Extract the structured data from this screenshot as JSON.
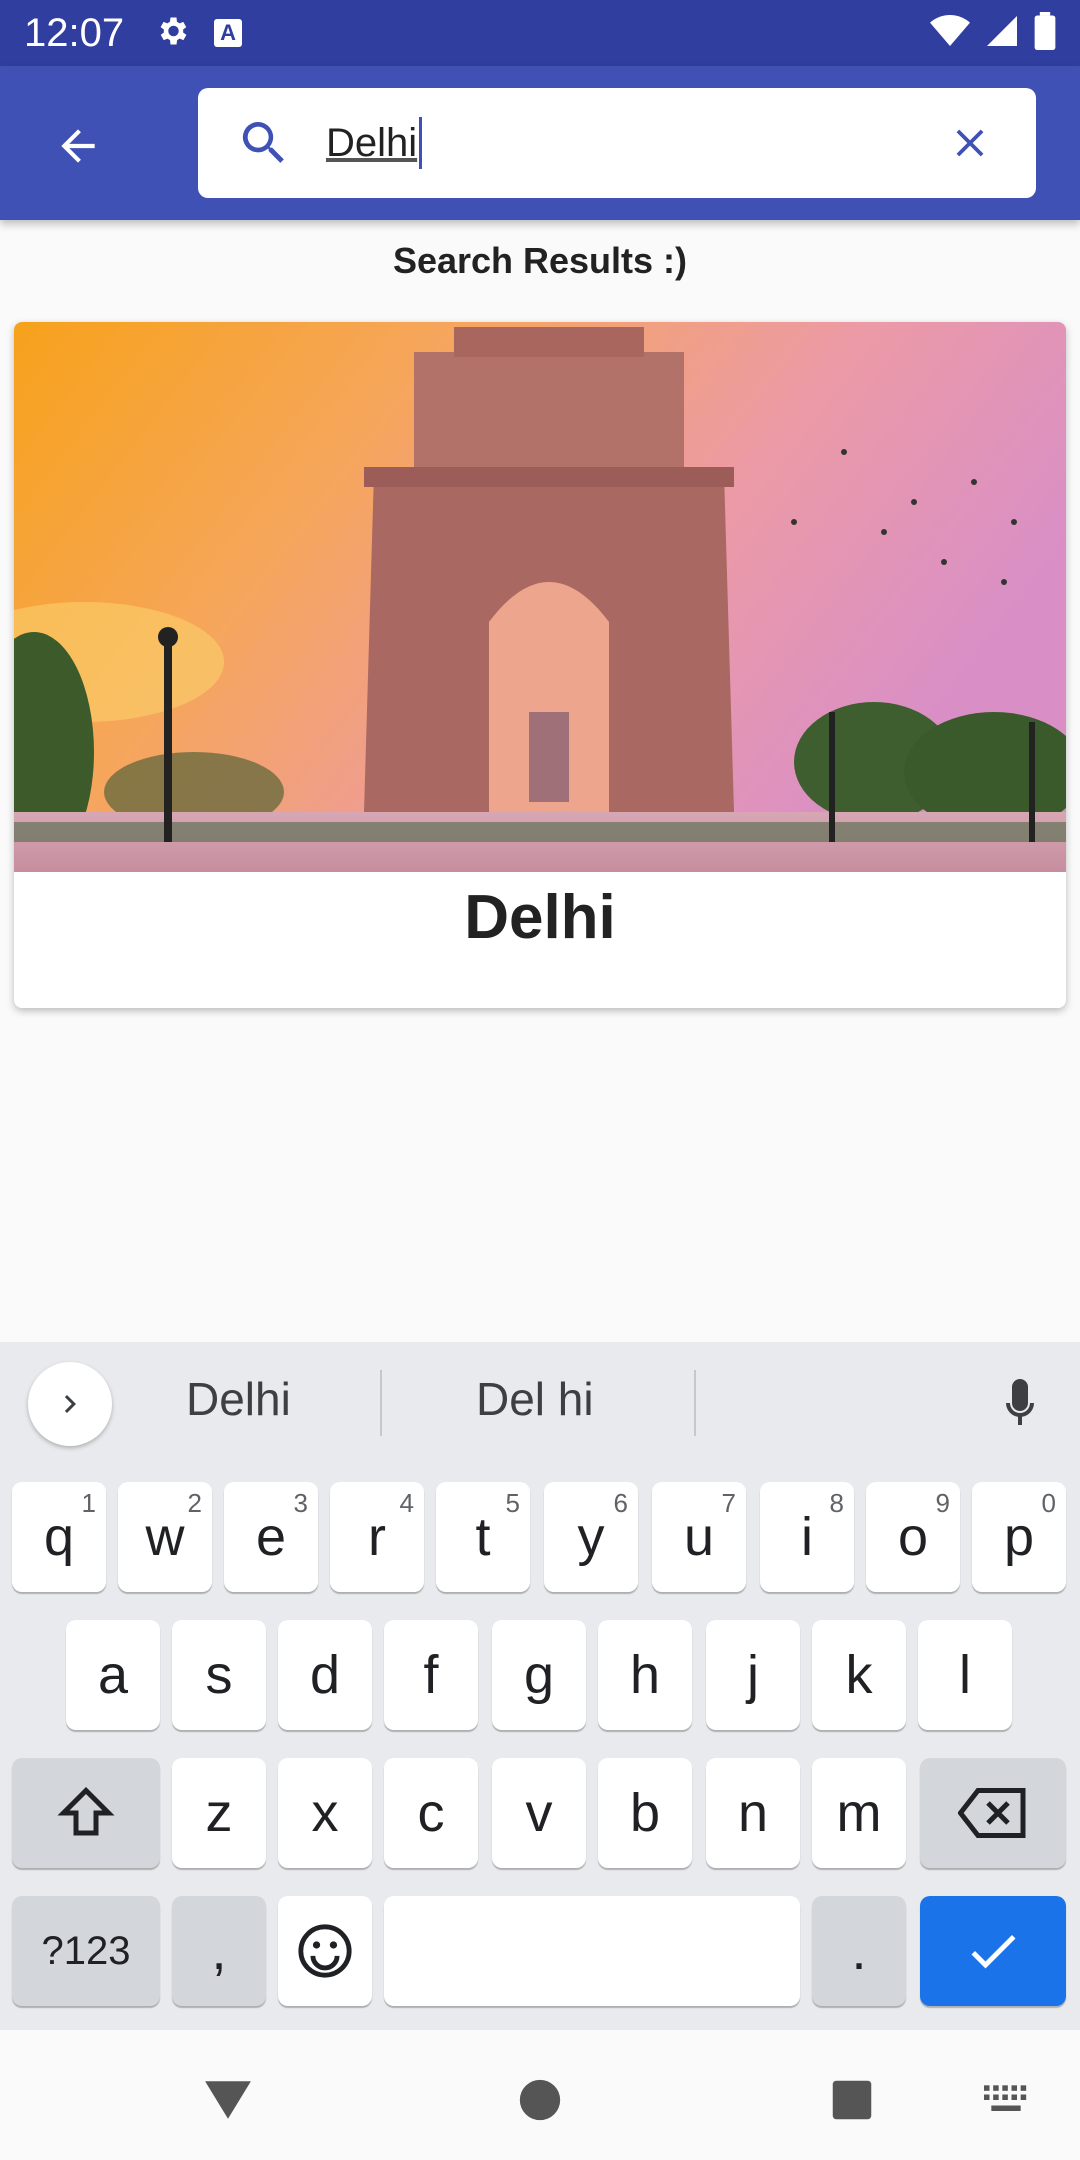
{
  "status_bar": {
    "time": "12:07",
    "icons": [
      "settings-icon",
      "keyboard-a-icon",
      "wifi-icon",
      "signal-icon",
      "battery-icon"
    ],
    "a_label": "A"
  },
  "app_bar": {
    "back_icon": "arrow-back-icon",
    "search": {
      "icon": "search-icon",
      "value": "Delhi",
      "clear_icon": "close-icon"
    },
    "color": "#3f51b5"
  },
  "results": {
    "heading": "Search Results :)",
    "cards": [
      {
        "title": "Delhi",
        "image": "india-gate-photo"
      }
    ]
  },
  "keyboard": {
    "suggestions": [
      "Delhi",
      "Del hi"
    ],
    "row1": [
      {
        "key": "q",
        "hint": "1"
      },
      {
        "key": "w",
        "hint": "2"
      },
      {
        "key": "e",
        "hint": "3"
      },
      {
        "key": "r",
        "hint": "4"
      },
      {
        "key": "t",
        "hint": "5"
      },
      {
        "key": "y",
        "hint": "6"
      },
      {
        "key": "u",
        "hint": "7"
      },
      {
        "key": "i",
        "hint": "8"
      },
      {
        "key": "o",
        "hint": "9"
      },
      {
        "key": "p",
        "hint": "0"
      }
    ],
    "row2": [
      "a",
      "s",
      "d",
      "f",
      "g",
      "h",
      "j",
      "k",
      "l"
    ],
    "row3": [
      "z",
      "x",
      "c",
      "v",
      "b",
      "n",
      "m"
    ],
    "symbols_label": "?123",
    "comma": ",",
    "period": ".",
    "action_color": "#1a73e8"
  },
  "nav_bar": {
    "icons": [
      "back-triangle-icon",
      "home-circle-icon",
      "recents-square-icon",
      "keyboard-switch-icon"
    ]
  }
}
